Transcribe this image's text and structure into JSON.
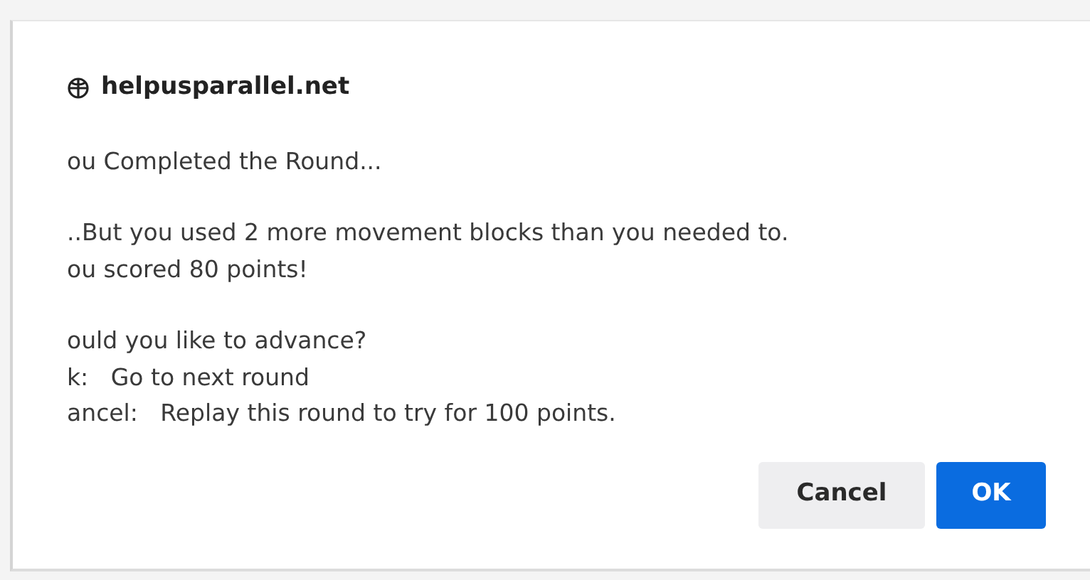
{
  "dialog": {
    "title": "helpusparallel.net",
    "paragraphs": [
      [
        "ou Completed the Round..."
      ],
      [
        "..But you used 2 more movement blocks than you needed to.",
        "ou scored 80 points!"
      ],
      [
        "ould you like to advance?",
        "k:   Go to next round",
        "ancel:   Replay this round to try for 100 points."
      ]
    ],
    "buttons": [
      {
        "label": "Cancel",
        "kind": "secondary"
      },
      {
        "label": "OK",
        "kind": "primary"
      }
    ]
  }
}
